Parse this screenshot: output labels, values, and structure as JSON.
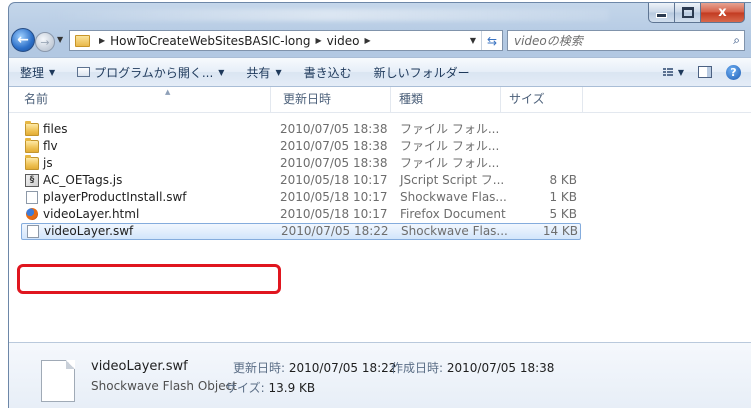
{
  "window": {
    "caption_buttons": {
      "minimize": "minimize-icon",
      "maximize": "maximize-icon",
      "close_label": "x"
    }
  },
  "nav": {
    "back_icon": "back-arrow-icon",
    "forward_icon": "forward-arrow-icon",
    "breadcrumb": [
      "HowToCreateWebSitesBASIC-long",
      "video"
    ],
    "search_placeholder": "videoの検索"
  },
  "toolbar": {
    "organize": "整理",
    "open_with": "プログラムから開く...",
    "share": "共有",
    "burn": "書き込む",
    "new_folder": "新しいフォルダー"
  },
  "columns": {
    "name": "名前",
    "date": "更新日時",
    "type": "種類",
    "size": "サイズ"
  },
  "files": [
    {
      "name": "files",
      "date": "2010/07/05 18:38",
      "type": "ファイル フォル...",
      "size": "",
      "icon": "folder-icon"
    },
    {
      "name": "flv",
      "date": "2010/07/05 18:38",
      "type": "ファイル フォル...",
      "size": "",
      "icon": "folder-icon"
    },
    {
      "name": "js",
      "date": "2010/07/05 18:38",
      "type": "ファイル フォル...",
      "size": "",
      "icon": "folder-icon"
    },
    {
      "name": "AC_OETags.js",
      "date": "2010/05/18 10:17",
      "type": "JScript Script フ...",
      "size": "8 KB",
      "icon": "script-icon"
    },
    {
      "name": "playerProductInstall.swf",
      "date": "2010/05/18 10:17",
      "type": "Shockwave Flas...",
      "size": "1 KB",
      "icon": "document-icon"
    },
    {
      "name": "videoLayer.html",
      "date": "2010/05/18 10:17",
      "type": "Firefox Document",
      "size": "5 KB",
      "icon": "firefox-icon"
    },
    {
      "name": "videoLayer.swf",
      "date": "2010/07/05 18:22",
      "type": "Shockwave Flas...",
      "size": "14 KB",
      "icon": "document-icon",
      "selected": true
    }
  ],
  "details": {
    "name": "videoLayer.swf",
    "type": "Shockwave Flash Object",
    "modified_label": "更新日時:",
    "modified_value": "2010/07/05 18:22",
    "created_label": "作成日時:",
    "created_value": "2010/07/05 18:38",
    "size_label": "サイズ:",
    "size_value": "13.9 KB"
  },
  "colors": {
    "selection_border": "#84acdd",
    "annotation_red": "#e0161f",
    "toolbar_text": "#1e395b"
  }
}
